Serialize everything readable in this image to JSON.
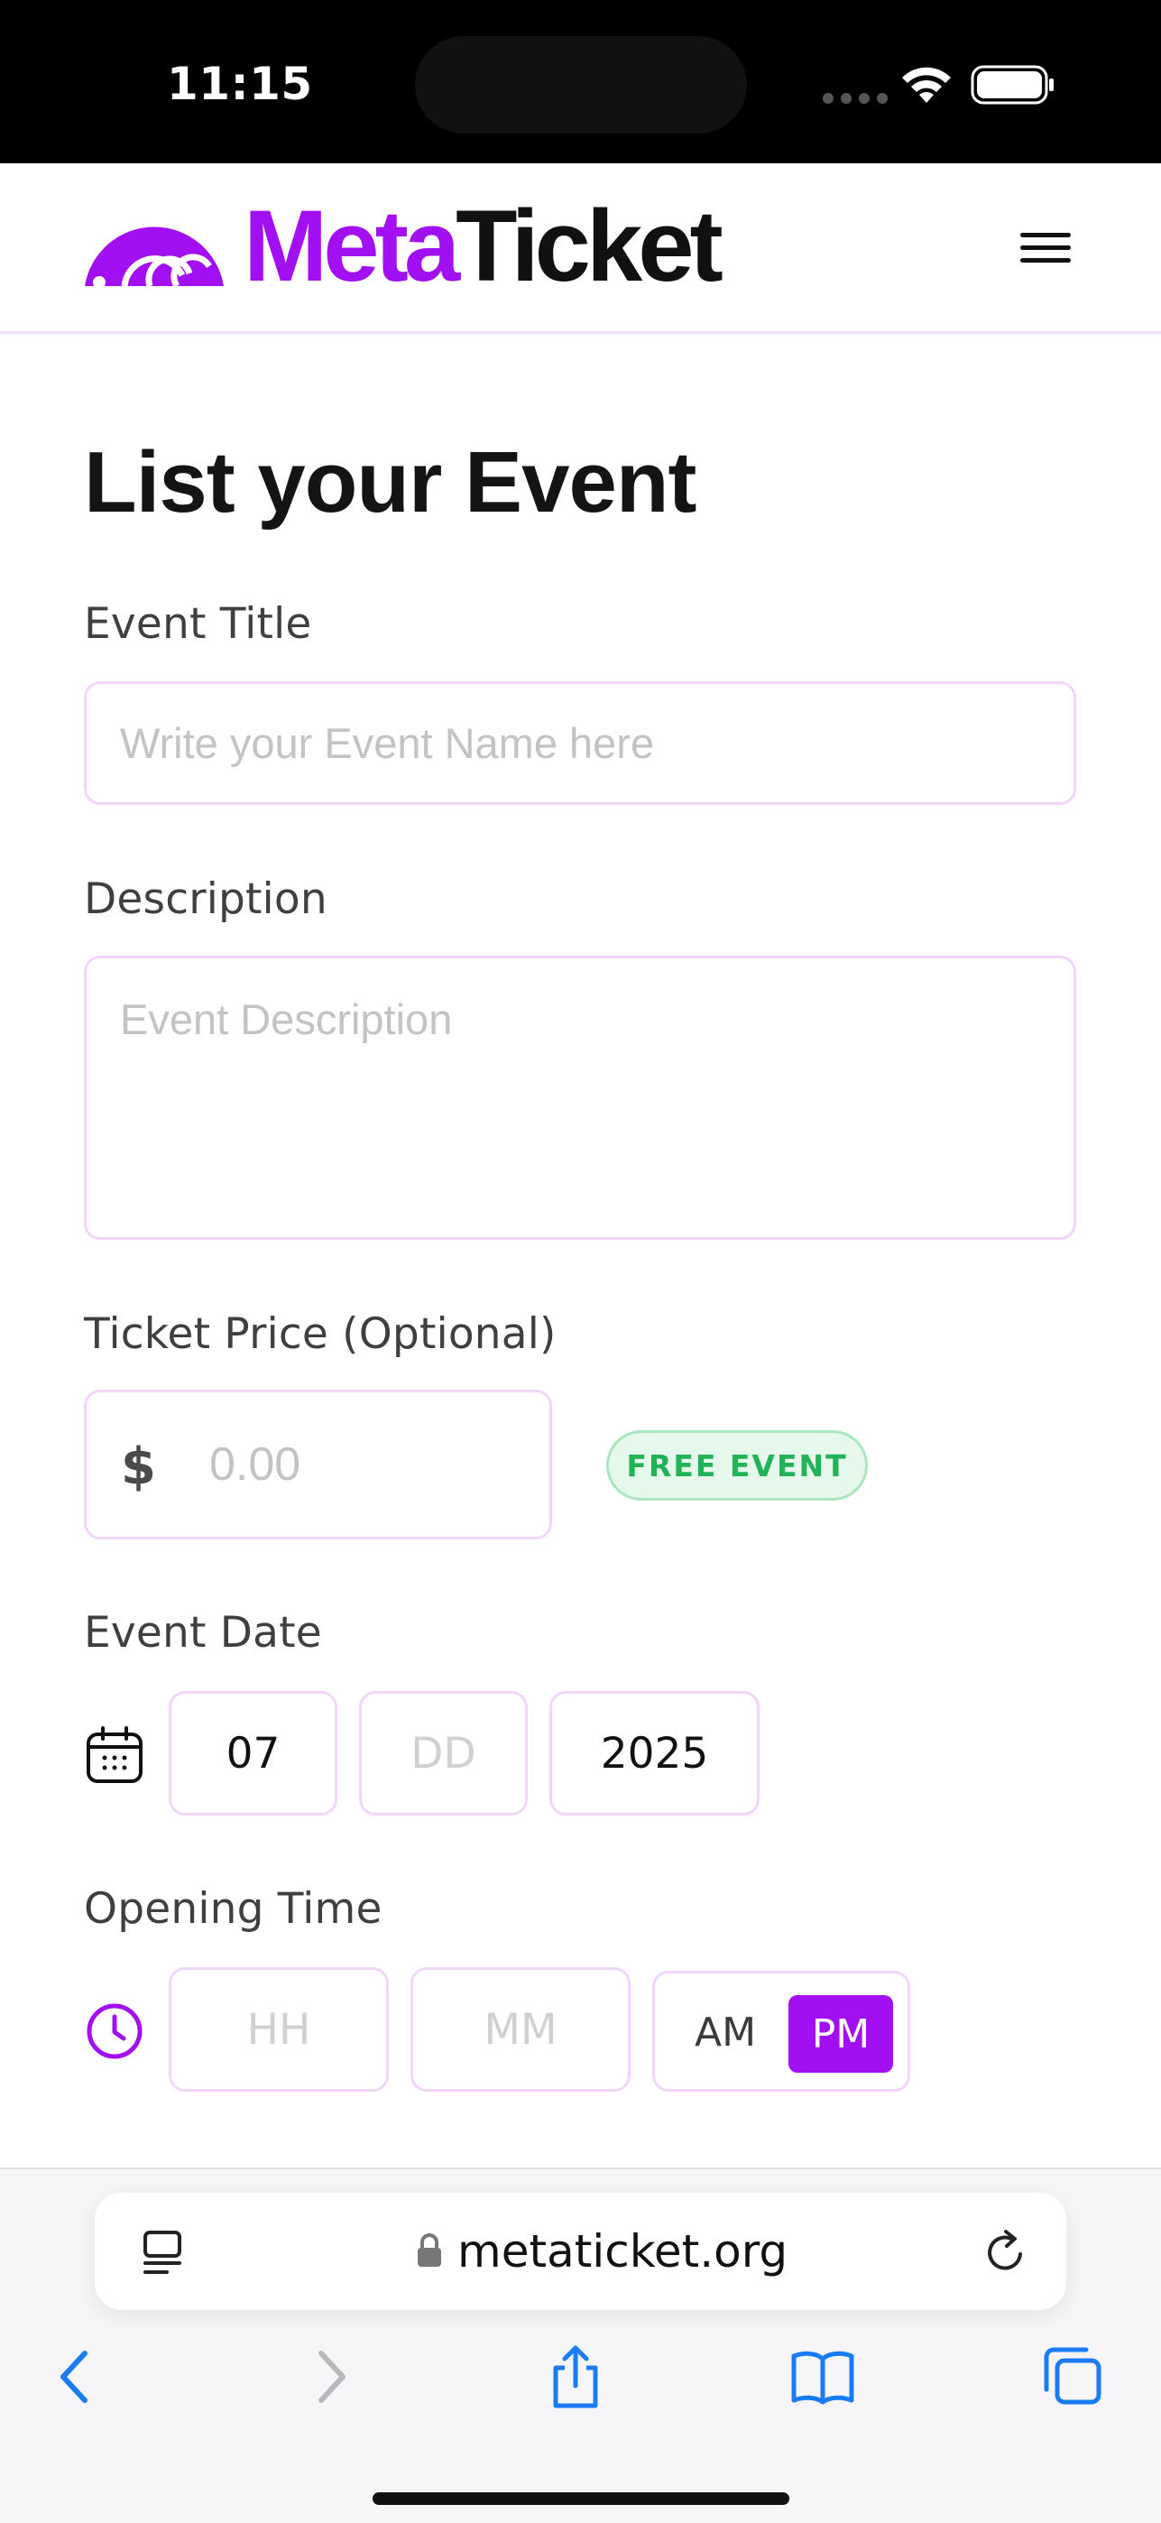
{
  "status_bar": {
    "time": "11:15"
  },
  "header": {
    "logo_meta": "Meta",
    "logo_ticket": "Ticket"
  },
  "form": {
    "title": "List your Event",
    "event_title": {
      "label": "Event Title",
      "placeholder": "Write your Event Name here",
      "value": ""
    },
    "description": {
      "label": "Description",
      "placeholder": "Event Description",
      "value": ""
    },
    "ticket_price": {
      "label": "Ticket Price (Optional)",
      "currency": "$",
      "placeholder": "0.00",
      "badge": "FREE EVENT"
    },
    "event_date": {
      "label": "Event Date",
      "month": "07",
      "day_placeholder": "DD",
      "year": "2025"
    },
    "opening_time": {
      "label": "Opening Time",
      "hour_placeholder": "HH",
      "minute_placeholder": "MM",
      "am": "AM",
      "pm": "PM",
      "selected": "PM"
    }
  },
  "browser": {
    "url": "metaticket.org"
  },
  "colors": {
    "brand": "#a10ff2",
    "border": "#f1d6f9",
    "free_badge_text": "#22b357",
    "safari_blue": "#1a7cf5"
  },
  "icons": [
    "wifi-icon",
    "battery-icon",
    "hamburger-menu-icon",
    "calendar-icon",
    "clock-icon",
    "reader-icon",
    "lock-icon",
    "reload-icon",
    "back-icon",
    "forward-icon",
    "share-icon",
    "bookmarks-icon",
    "tabs-icon"
  ]
}
